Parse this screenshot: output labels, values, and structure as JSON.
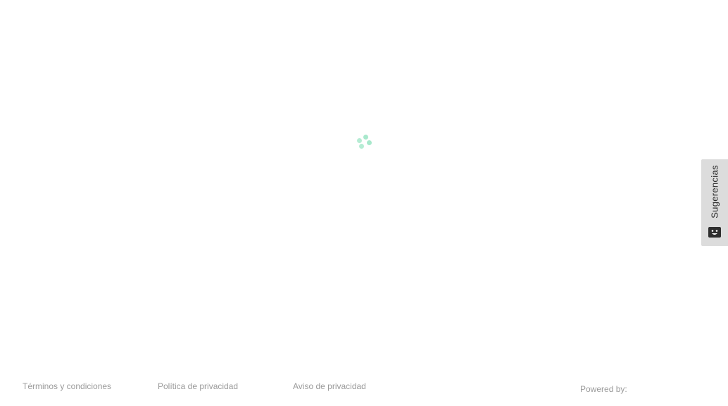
{
  "loading": {
    "spinner_icon": "loading-spinner-icon",
    "color": "#a8e8cc"
  },
  "feedback": {
    "label": "Sugerencias",
    "icon": "feedback-face-icon",
    "background": "#dcdcdc"
  },
  "footer": {
    "links": [
      {
        "label": "Términos y condiciones"
      },
      {
        "label": "Política de privacidad"
      },
      {
        "label": "Aviso de privacidad"
      }
    ],
    "powered_by": "Powered by:"
  }
}
